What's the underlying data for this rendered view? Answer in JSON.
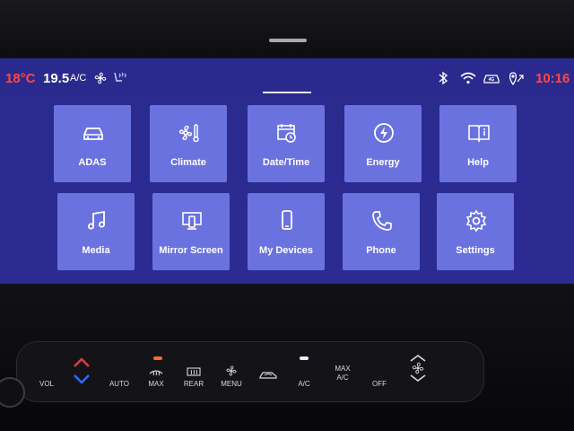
{
  "status_bar": {
    "driver_temp": "18°C",
    "passenger_temp": "19.5",
    "ac_label": "A/C",
    "clock": "10:16",
    "icons": [
      "fan-icon",
      "seat-airflow-icon",
      "bluetooth-icon",
      "wifi-icon",
      "car-connect-icon",
      "gps-icon"
    ]
  },
  "tiles": [
    {
      "label": "ADAS",
      "icon": "car-icon"
    },
    {
      "label": "Climate",
      "icon": "climate-icon"
    },
    {
      "label": "Date/Time",
      "icon": "calendar-clock-icon"
    },
    {
      "label": "Energy",
      "icon": "energy-icon"
    },
    {
      "label": "Help",
      "icon": "book-info-icon"
    },
    {
      "label": "Media",
      "icon": "music-note-icon"
    },
    {
      "label": "Mirror Screen",
      "icon": "mirror-screen-icon"
    },
    {
      "label": "My Devices",
      "icon": "phone-device-icon"
    },
    {
      "label": "Phone",
      "icon": "phone-handset-icon"
    },
    {
      "label": "Settings",
      "icon": "gear-icon"
    }
  ],
  "hardware_controls": {
    "vol": "VOL",
    "auto": "AUTO",
    "max": "MAX",
    "rear": "REAR",
    "menu": "MENU",
    "ac": "A/C",
    "max_ac_line1": "MAX",
    "max_ac_line2": "A/C",
    "off": "OFF"
  },
  "colors": {
    "screen_bg": "#2b2b92",
    "tile_bg": "#6a72df",
    "warm_red": "#ff4747",
    "led_orange": "#ff6a2b",
    "led_white": "#e8eeff",
    "arrow_red": "#e43a3a",
    "arrow_blue": "#2f6bff"
  }
}
